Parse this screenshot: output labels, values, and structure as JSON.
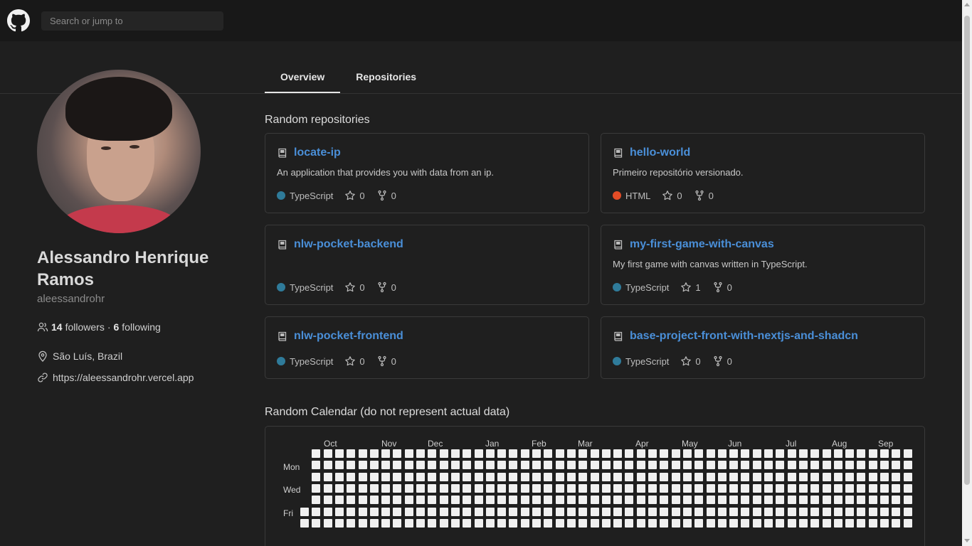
{
  "header": {
    "logo_icon": "github-logo-icon",
    "search_placeholder": "Search or jump to"
  },
  "tabs": [
    {
      "label": "Overview",
      "active": true
    },
    {
      "label": "Repositories",
      "active": false
    }
  ],
  "profile": {
    "full_name": "Alessandro Henrique Ramos",
    "username": "aleessandrohr",
    "followers_count": "14",
    "followers_label": "followers",
    "separator": "·",
    "following_count": "6",
    "following_label": "following",
    "location": "São Luís, Brazil",
    "website": "https://aleessandrohr.vercel.app"
  },
  "repositories": {
    "title": "Random repositories",
    "items": [
      {
        "name": "locate-ip",
        "description": "An application that provides you with data from an ip.",
        "language": "TypeScript",
        "language_color": "#2f7b9a",
        "stars": "0",
        "forks": "0"
      },
      {
        "name": "hello-world",
        "description": "Primeiro repositório versionado.",
        "language": "HTML",
        "language_color": "#e34c26",
        "stars": "0",
        "forks": "0"
      },
      {
        "name": "nlw-pocket-backend",
        "description": "",
        "language": "TypeScript",
        "language_color": "#2f7b9a",
        "stars": "0",
        "forks": "0"
      },
      {
        "name": "my-first-game-with-canvas",
        "description": "My first game with canvas written in TypeScript.",
        "language": "TypeScript",
        "language_color": "#2f7b9a",
        "stars": "1",
        "forks": "0"
      },
      {
        "name": "nlw-pocket-frontend",
        "description": "",
        "language": "TypeScript",
        "language_color": "#2f7b9a",
        "stars": "0",
        "forks": "0"
      },
      {
        "name": "base-project-front-with-nextjs-and-shadcn",
        "description": "",
        "language": "TypeScript",
        "language_color": "#2f7b9a",
        "stars": "0",
        "forks": "0"
      }
    ]
  },
  "calendar": {
    "title": "Random Calendar (do not represent actual data)",
    "months": [
      "Oct",
      "Nov",
      "Dec",
      "Jan",
      "Feb",
      "Mar",
      "Apr",
      "May",
      "Jun",
      "Jul",
      "Aug",
      "Sep"
    ],
    "days": [
      "Mon",
      "Wed",
      "Fri"
    ],
    "cell_color": "#f0f0f0"
  }
}
